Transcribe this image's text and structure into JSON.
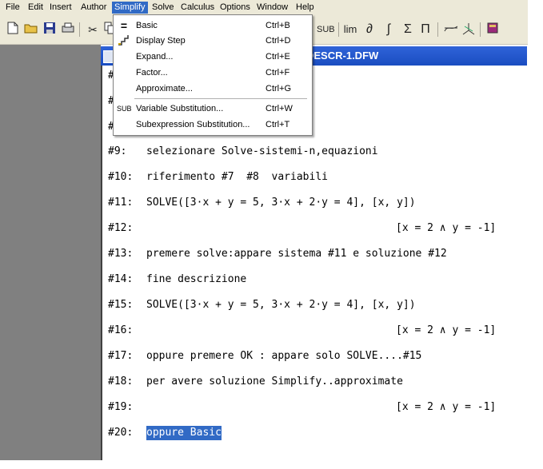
{
  "menubar": {
    "items": [
      {
        "label": "File"
      },
      {
        "label": "Edit"
      },
      {
        "label": "Insert"
      },
      {
        "label": "Author"
      },
      {
        "label": "Simplify"
      },
      {
        "label": "Solve"
      },
      {
        "label": "Calculus"
      },
      {
        "label": "Options"
      },
      {
        "label": "Window"
      },
      {
        "label": "Help"
      }
    ]
  },
  "toolbar": {
    "sub_label": "SUB",
    "lim_label": "lim",
    "deriv_label": "∂",
    "integral_label": "∫",
    "sum_label": "Σ",
    "product_label": "Π"
  },
  "window": {
    "title": "DESCR-1.DFW"
  },
  "simplify_menu": {
    "items": [
      {
        "label": "Basic",
        "shortcut": "Ctrl+B",
        "icon": "equals-icon"
      },
      {
        "label": "Display Step",
        "shortcut": "Ctrl+D",
        "icon": "steps-icon"
      },
      {
        "label": "Expand...",
        "shortcut": "Ctrl+E",
        "icon": ""
      },
      {
        "label": "Factor...",
        "shortcut": "Ctrl+F",
        "icon": ""
      },
      {
        "label": "Approximate...",
        "shortcut": "Ctrl+G",
        "icon": ""
      },
      {
        "label": "Variable Substitution...",
        "shortcut": "Ctrl+W",
        "icon": "sub-icon"
      },
      {
        "label": "Subexpression Substitution...",
        "shortcut": "Ctrl+T",
        "icon": ""
      }
    ],
    "sub_icon_text": "SUB"
  },
  "document": {
    "partial_labels": [
      "#",
      "#",
      "#"
    ],
    "lines": [
      {
        "num": "#9:",
        "text": "selezionare Solve-sistemi-n,equazioni",
        "result": ""
      },
      {
        "num": "#10:",
        "text": "riferimento #7  #8  variabili",
        "result": ""
      },
      {
        "num": "#11:",
        "text": "SOLVE([3·x + y = 5, 3·x + 2·y = 4], [x, y])",
        "result": ""
      },
      {
        "num": "#12:",
        "text": "",
        "result": "[x = 2 ∧ y = -1]"
      },
      {
        "num": "#13:",
        "text": "premere solve:appare sistema #11 e soluzione #12",
        "result": ""
      },
      {
        "num": "#14:",
        "text": "fine descrizione",
        "result": ""
      },
      {
        "num": "#15:",
        "text": "SOLVE([3·x + y = 5, 3·x + 2·y = 4], [x, y])",
        "result": ""
      },
      {
        "num": "#16:",
        "text": "",
        "result": "[x = 2 ∧ y = -1]"
      },
      {
        "num": "#17:",
        "text": "oppure premere OK : appare solo SOLVE....#15",
        "result": ""
      },
      {
        "num": "#18:",
        "text": "per avere soluzione Simplify..approximate",
        "result": ""
      },
      {
        "num": "#19:",
        "text": "",
        "result": "[x = 2 ∧ y = -1]"
      },
      {
        "num": "#20:",
        "text": "oppure Basic",
        "result": ""
      }
    ]
  }
}
